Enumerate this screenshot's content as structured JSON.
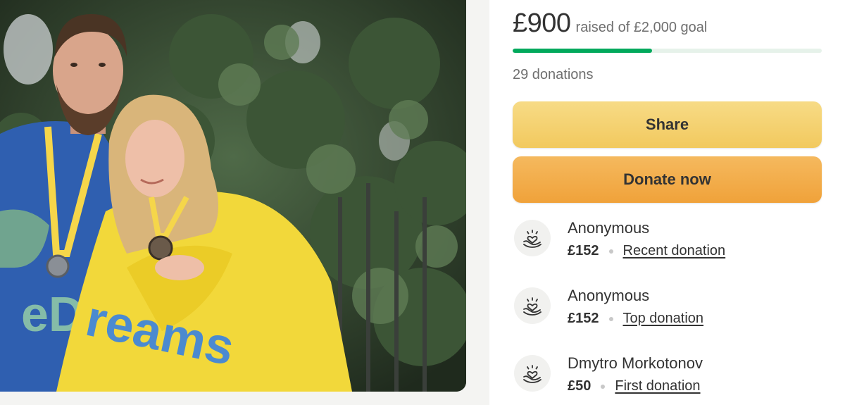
{
  "fundraiser": {
    "raised_amount": "£900",
    "raised_text": "raised of £2,000 goal",
    "progress_fraction": 0.45,
    "donations_count": "29 donations"
  },
  "buttons": {
    "share": "Share",
    "donate": "Donate now"
  },
  "donations": [
    {
      "name": "Anonymous",
      "amount": "£152",
      "label": "Recent donation"
    },
    {
      "name": "Anonymous",
      "amount": "£152",
      "label": "Top donation"
    },
    {
      "name": "Dmytro Morkotonov",
      "amount": "£50",
      "label": "First donation"
    }
  ],
  "photo": {
    "description_icon": "fundraiser-photo"
  },
  "colors": {
    "progress": "#02a95c",
    "share_button": "#f2c95e",
    "donate_button": "#f0a23a"
  }
}
